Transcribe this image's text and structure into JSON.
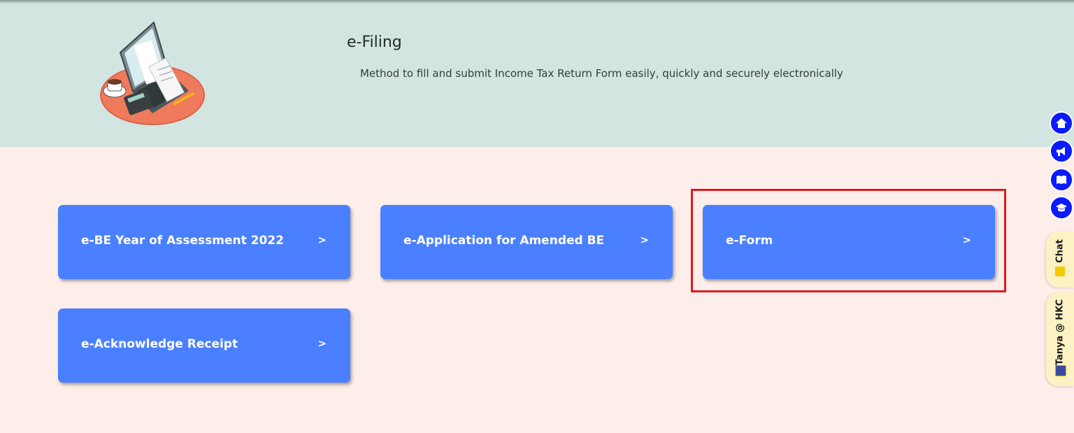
{
  "hero": {
    "title": "e-Filing",
    "subtitle": "Method to fill and submit Income Tax Return Form easily, quickly and securely electronically"
  },
  "cards": [
    {
      "label": "e-BE Year of Assessment 2022",
      "arrow": ">"
    },
    {
      "label": "e-Application for Amended BE",
      "arrow": ">"
    },
    {
      "label": "e-Form",
      "arrow": ">",
      "highlighted": true
    },
    {
      "label": "e-Acknowledge Receipt",
      "arrow": ">"
    }
  ],
  "side_toolbar": {
    "buttons": [
      "home-icon",
      "megaphone-icon",
      "book-icon",
      "graduation-cap-icon"
    ],
    "chat_label": "Chat",
    "tanya_label": "Tanya @ HKC"
  },
  "colors": {
    "hero_bg": "#d2e5e1",
    "page_bg": "#fdeeea",
    "card_bg": "#4a80ff",
    "highlight": "#e0191e",
    "side_button": "#0a1bff",
    "side_tab": "#fdf2c4"
  }
}
